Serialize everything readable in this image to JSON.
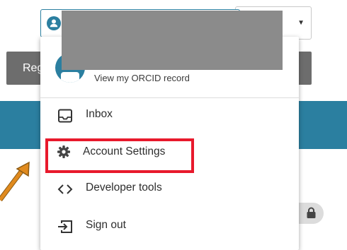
{
  "background": {
    "register_button_label": "Reg"
  },
  "user_menu": {
    "items": [
      {
        "label": "View my ORCID record",
        "icon": "person-icon"
      },
      {
        "label": "Inbox",
        "icon": "inbox-icon"
      },
      {
        "label": "Account Settings",
        "icon": "gear-icon"
      },
      {
        "label": "Developer tools",
        "icon": "code-brackets-icon"
      },
      {
        "label": "Sign out",
        "icon": "sign-out-icon"
      }
    ]
  },
  "language_select": {
    "caret": "▼"
  },
  "colors": {
    "brand": "#2b7fa0",
    "highlight": "#e8192c",
    "arrow": "#e08a1e",
    "button_gray": "#6d6d6d",
    "redaction": "#8b8b8b"
  }
}
